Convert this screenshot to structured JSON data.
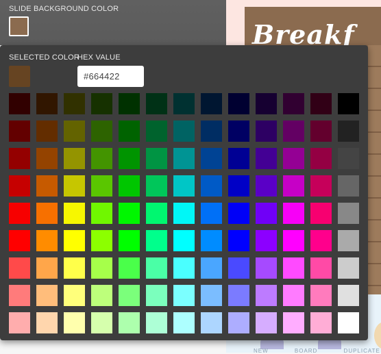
{
  "top": {
    "label": "SLIDE BACKGROUND COLOR",
    "current_color": "#8b6b4f"
  },
  "slide": {
    "title": "Breakf",
    "background_color": "#8b6b4f",
    "bottom_labels": "NEW BOARD   DUPLICATE"
  },
  "picker": {
    "selected_label": "SELECTED COLOR",
    "hex_label": "HEX VALUE",
    "selected_color": "#664422",
    "hex_value": "#664422",
    "palette": [
      [
        "#310000",
        "#311600",
        "#313100",
        "#163100",
        "#003100",
        "#003116",
        "#003131",
        "#001631",
        "#000031",
        "#160031",
        "#310031",
        "#310016",
        "#000000"
      ],
      [
        "#630000",
        "#632d00",
        "#636300",
        "#2d6300",
        "#006300",
        "#00632d",
        "#006363",
        "#002d63",
        "#000063",
        "#2d0063",
        "#630063",
        "#63002d",
        "#222222"
      ],
      [
        "#940000",
        "#944300",
        "#949400",
        "#439400",
        "#009400",
        "#009443",
        "#009494",
        "#004394",
        "#000094",
        "#430094",
        "#940094",
        "#940043",
        "#444444"
      ],
      [
        "#c60000",
        "#c65a00",
        "#c6c600",
        "#5ac600",
        "#00c600",
        "#00c65a",
        "#00c6c6",
        "#005ac6",
        "#0000c6",
        "#5a00c6",
        "#c600c6",
        "#c6005a",
        "#666666"
      ],
      [
        "#f70000",
        "#f77000",
        "#f7f700",
        "#70f700",
        "#00f700",
        "#00f770",
        "#00f7f7",
        "#0070f7",
        "#0000f7",
        "#7000f7",
        "#f700f7",
        "#f70070",
        "#888888"
      ],
      [
        "#ff0000",
        "#ff8c00",
        "#ffff00",
        "#8cff00",
        "#00ff00",
        "#00ff8c",
        "#00ffff",
        "#008cff",
        "#0000ff",
        "#8c00ff",
        "#ff00ff",
        "#ff008c",
        "#aaaaaa"
      ],
      [
        "#ff4a4a",
        "#ffa64a",
        "#ffff4a",
        "#a6ff4a",
        "#4aff4a",
        "#4affa6",
        "#4affff",
        "#4aa6ff",
        "#4a4aff",
        "#a64aff",
        "#ff4aff",
        "#ff4aa6",
        "#cccccc"
      ],
      [
        "#ff7b7b",
        "#ffbd7b",
        "#ffff7b",
        "#bdff7b",
        "#7bff7b",
        "#7bffbd",
        "#7bffff",
        "#7bbdff",
        "#7b7bff",
        "#bd7bff",
        "#ff7bff",
        "#ff7bbd",
        "#e0e0e0"
      ],
      [
        "#ffadad",
        "#ffd6ad",
        "#ffffad",
        "#d6ffad",
        "#adffad",
        "#adffd6",
        "#adffff",
        "#add6ff",
        "#adadff",
        "#d6adff",
        "#ffadff",
        "#ffadd6",
        "#ffffff"
      ]
    ]
  }
}
